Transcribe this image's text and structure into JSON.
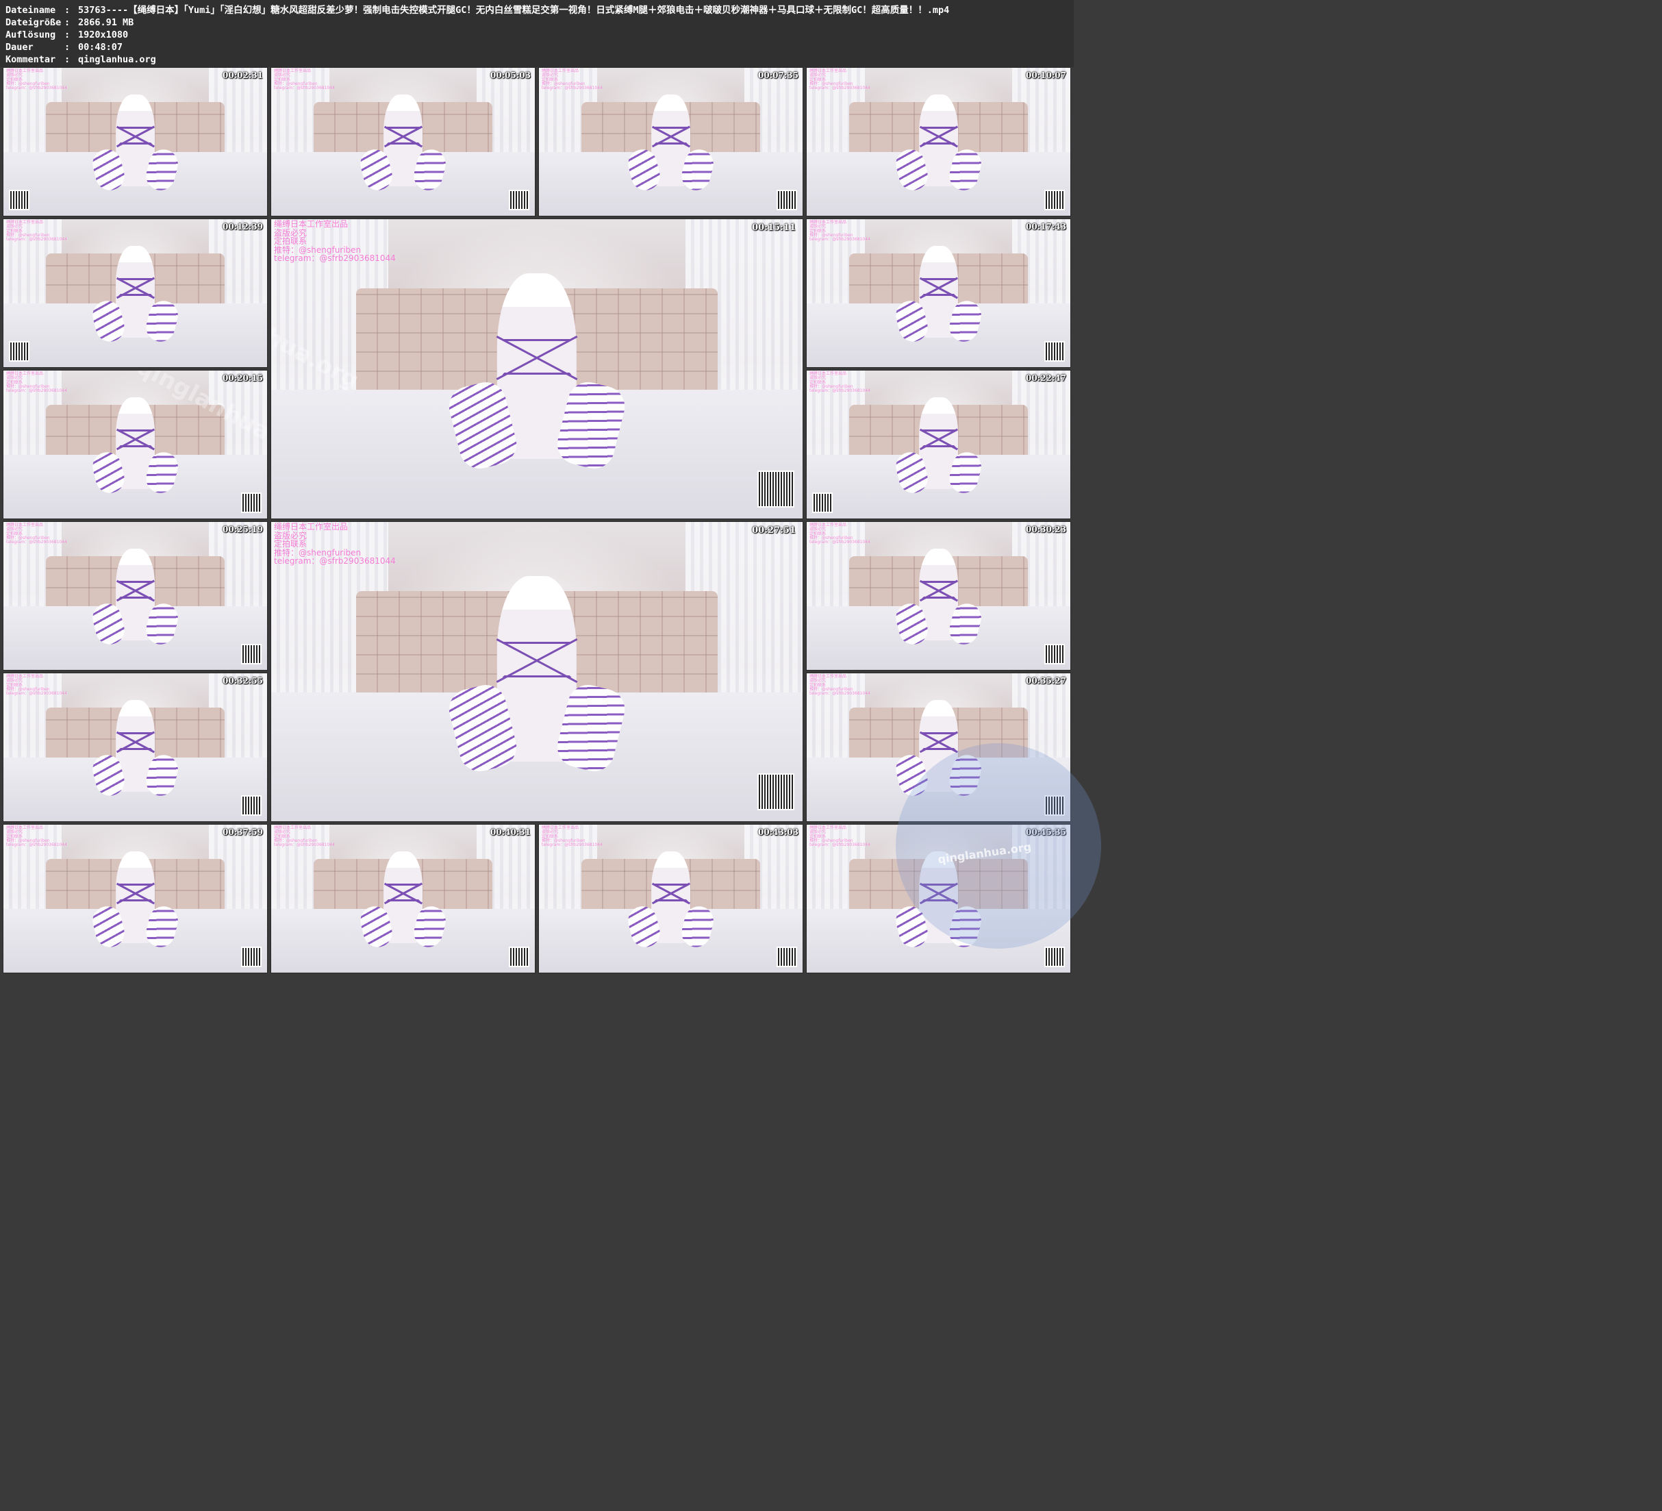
{
  "metadata": [
    {
      "key": "Dateiname",
      "value": "53763----【绳缚日本】「Yumi」「淫白幻想」糖水风超甜反差少萝！强制电击失控模式开腿GC！无内白丝雪糕足交第一视角！日式紧缚M腿＋郊狼电击＋啵啵贝秒潮神器＋马具口球＋无限制GC！超高质量！！.mp4"
    },
    {
      "key": "Dateigröße",
      "value": "2866.91 MB"
    },
    {
      "key": "Auflösung",
      "value": "1920x1080"
    },
    {
      "key": "Dauer",
      "value": "00:48:07"
    },
    {
      "key": "Kommentar",
      "value": "qinglanhua.org"
    }
  ],
  "separator": ":",
  "watermark": {
    "line1": "绳缚日本工作室出品",
    "line2": "盗版必究",
    "line3": "定拍联系",
    "line4": "推特：@shengfuriben",
    "line5": "telegram：@sfrb2903681044"
  },
  "diagonal_watermark": "qinglanhua.org",
  "site_badge": "qinglanhua.org",
  "thumbnails": [
    {
      "time": "00:02:31"
    },
    {
      "time": "00:05:03"
    },
    {
      "time": "00:07:35"
    },
    {
      "time": "00:10:07"
    },
    {
      "time": "00:12:39"
    },
    {
      "time": "00:15:11"
    },
    {
      "time": "00:17:43"
    },
    {
      "time": "00:20:15"
    },
    {
      "time": "00:22:47"
    },
    {
      "time": "00:25:19"
    },
    {
      "time": "00:27:51"
    },
    {
      "time": "00:30:23"
    },
    {
      "time": "00:32:55"
    },
    {
      "time": "00:35:27"
    },
    {
      "time": "00:37:59"
    },
    {
      "time": "00:40:31"
    },
    {
      "time": "00:43:03"
    },
    {
      "time": "00:45:35"
    }
  ],
  "colors": {
    "header_bg": "#303030",
    "page_bg": "#3a3a3a",
    "watermark_pink": "#f47ad4",
    "rope_purple": "#7b4fb3"
  }
}
